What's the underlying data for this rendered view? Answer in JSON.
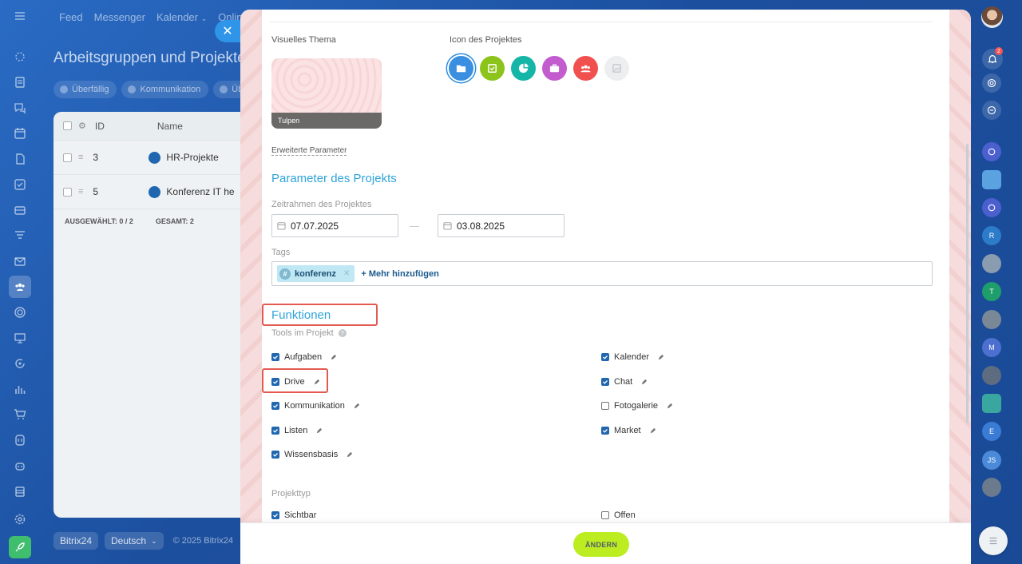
{
  "topnav": {
    "items": [
      "Feed",
      "Messenger",
      "Kalender",
      "Online"
    ]
  },
  "page": {
    "title": "Arbeitsgruppen und Projekte",
    "filters": [
      "Überfällig",
      "Kommunikation",
      "Über"
    ],
    "grid": {
      "columns": [
        "ID",
        "Name"
      ],
      "rows": [
        {
          "id": "3",
          "name": "HR-Projekte"
        },
        {
          "id": "5",
          "name": "Konferenz IT he"
        }
      ],
      "selected_label": "AUSGEWÄHLT: 0 / 2",
      "total_label": "GESAMT: 2"
    }
  },
  "footer": {
    "brand": "Bitrix24",
    "language": "Deutsch",
    "copyright": "© 2025 Bitrix24"
  },
  "slider": {
    "visual_theme_label": "Visuelles Thema",
    "theme_name": "Tulpen",
    "project_icon_label": "Icon des Projektes",
    "project_icons": [
      {
        "name": "folder-icon",
        "color": "#3b8fe0"
      },
      {
        "name": "checklist-icon",
        "color": "#8cc41b"
      },
      {
        "name": "pie-chart-icon",
        "color": "#15b5a8"
      },
      {
        "name": "briefcase-icon",
        "color": "#c35ccf"
      },
      {
        "name": "group-icon",
        "color": "#f0514f"
      },
      {
        "name": "image-icon",
        "color": "#eceeef"
      }
    ],
    "advanced_link": "Erweiterte Parameter",
    "params_heading": "Parameter des Projekts",
    "timeframe_label": "Zeitrahmen des Projektes",
    "date_start": "07.07.2025",
    "date_end": "03.08.2025",
    "tags_label": "Tags",
    "tag": "konferenz",
    "add_more": "+ Mehr hinzufügen",
    "functions_heading": "Funktionen",
    "tools_label": "Tools im Projekt",
    "tools_left": [
      {
        "label": "Aufgaben",
        "checked": true
      },
      {
        "label": "Drive",
        "checked": true
      },
      {
        "label": "Kommunikation",
        "checked": true
      },
      {
        "label": "Listen",
        "checked": true
      },
      {
        "label": "Wissensbasis",
        "checked": true
      }
    ],
    "tools_right": [
      {
        "label": "Kalender",
        "checked": true
      },
      {
        "label": "Chat",
        "checked": true
      },
      {
        "label": "Fotogalerie",
        "checked": false
      },
      {
        "label": "Market",
        "checked": true
      }
    ],
    "project_type_label": "Projekttyp",
    "type_visible": "Sichtbar",
    "type_open": "Offen",
    "save_button": "ÄNDERN"
  },
  "notifications": {
    "count": "2"
  },
  "right_avatars": [
    "R",
    "T",
    "M",
    "E",
    "JS"
  ]
}
